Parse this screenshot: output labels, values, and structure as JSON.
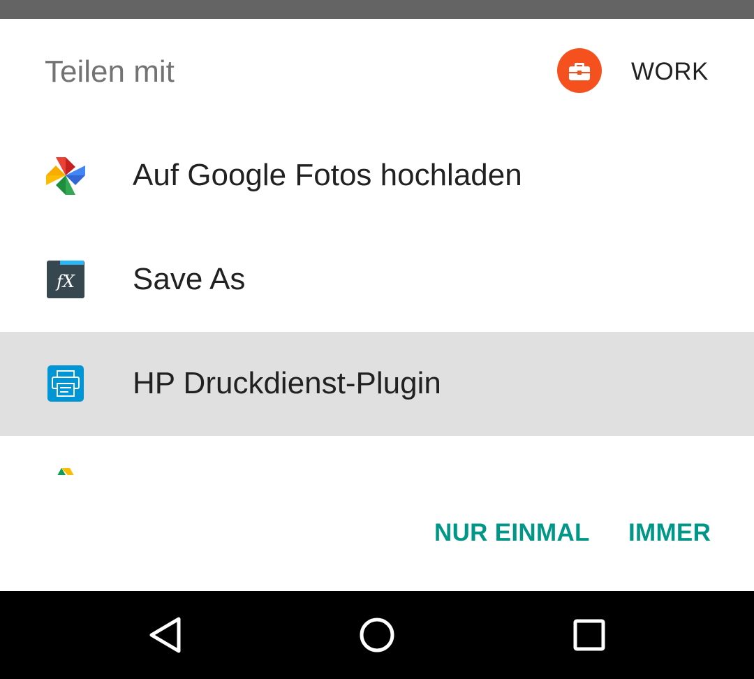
{
  "dialog": {
    "title": "Teilen mit",
    "profile_tab": {
      "label": "WORK",
      "icon": "briefcase-icon",
      "color": "#f4511e"
    }
  },
  "apps": [
    {
      "label": "Auf Google Fotos hochladen",
      "icon": "google-photos-icon",
      "selected": false
    },
    {
      "label": "Save As",
      "icon": "fx-file-explorer-icon",
      "selected": false
    },
    {
      "label": "HP Druckdienst-Plugin",
      "icon": "hp-print-service-icon",
      "selected": true
    },
    {
      "label": "",
      "icon": "google-drive-icon",
      "selected": false
    }
  ],
  "actions": {
    "just_once": "NUR EINMAL",
    "always": "IMMER",
    "color": "#009688"
  },
  "navigation_bar": {
    "buttons": [
      "back-icon",
      "home-icon",
      "recents-icon"
    ]
  }
}
